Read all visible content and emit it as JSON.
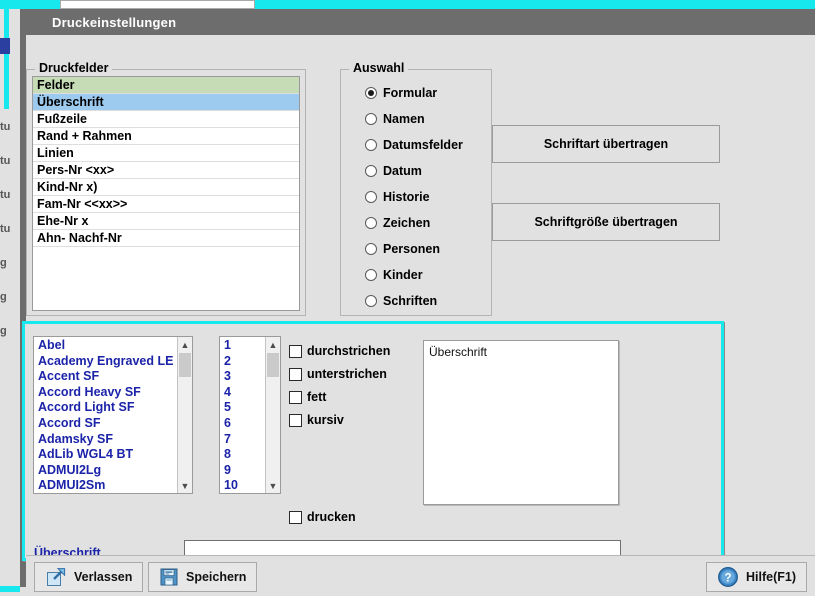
{
  "window": {
    "title": "Druckeinstellungen"
  },
  "background_window": {
    "side_labels": [
      "tu",
      "tu",
      "tu",
      "tu",
      "g",
      "g",
      "g"
    ]
  },
  "print_fields": {
    "group_label": "Druckfelder",
    "items": [
      {
        "label": "Felder",
        "state": "header"
      },
      {
        "label": "Überschrift",
        "state": "selected"
      },
      {
        "label": "Fußzeile",
        "state": "normal"
      },
      {
        "label": "Rand + Rahmen",
        "state": "normal"
      },
      {
        "label": "Linien",
        "state": "normal"
      },
      {
        "label": "Pers-Nr <xx>",
        "state": "normal"
      },
      {
        "label": "Kind-Nr x)",
        "state": "normal"
      },
      {
        "label": "Fam-Nr <<xx>>",
        "state": "normal"
      },
      {
        "label": "Ehe-Nr x",
        "state": "normal"
      },
      {
        "label": "Ahn- Nachf-Nr",
        "state": "normal"
      }
    ],
    "header_color": "#c6dcb6",
    "selected_color": "#9dcbf0"
  },
  "selection": {
    "group_label": "Auswahl",
    "options": [
      {
        "label": "Formular",
        "checked": true
      },
      {
        "label": "Namen",
        "checked": false
      },
      {
        "label": "Datumsfelder",
        "checked": false
      },
      {
        "label": "Datum",
        "checked": false
      },
      {
        "label": "Historie",
        "checked": false
      },
      {
        "label": "Zeichen",
        "checked": false
      },
      {
        "label": "Personen",
        "checked": false
      },
      {
        "label": "Kinder",
        "checked": false
      },
      {
        "label": "Schriften",
        "checked": false
      }
    ]
  },
  "transfer_buttons": {
    "font_family": "Schriftart übertragen",
    "font_size": "Schriftgröße übertragen"
  },
  "font_panel": {
    "border_color": "#16e8ee",
    "font_list": [
      "Abel",
      "Academy Engraved LE",
      "Accent SF",
      "Accord Heavy SF",
      "Accord Light SF",
      "Accord SF",
      "Adamsky SF",
      "AdLib WGL4 BT",
      "ADMUI2Lg",
      "ADMUI2Sm"
    ],
    "size_list": [
      "1",
      "2",
      "3",
      "4",
      "5",
      "6",
      "7",
      "8",
      "9",
      "10"
    ],
    "text_color": "#1b23a8",
    "style_checkboxes": [
      {
        "label": "durchstrichen",
        "checked": false
      },
      {
        "label": "unterstrichen",
        "checked": false
      },
      {
        "label": "fett",
        "checked": false
      },
      {
        "label": "kursiv",
        "checked": false
      }
    ],
    "print_checkbox": {
      "label": "drucken",
      "checked": false
    },
    "preview_text": "Überschrift",
    "field_label": "Überschrift",
    "field_value": ""
  },
  "footer": {
    "leave_label": "Verlassen",
    "save_label": "Speichern",
    "help_label": "Hilfe(F1)"
  }
}
